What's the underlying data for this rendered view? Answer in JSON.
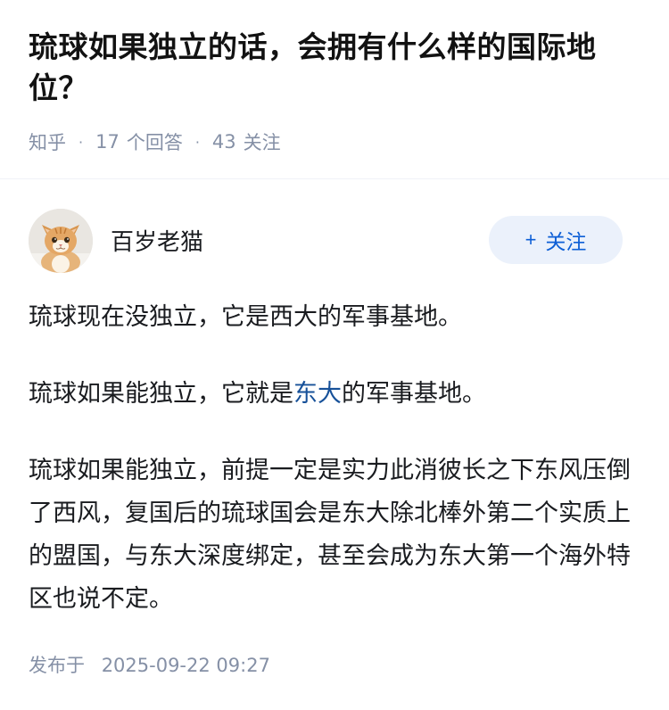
{
  "question": {
    "title": "琉球如果独立的话，会拥有什么样的国际地位？",
    "source": "知乎",
    "answer_count": "17",
    "answer_label": "个回答",
    "follower_count": "43",
    "follower_label": "关注"
  },
  "author": {
    "name": "百岁老猫",
    "avatar_icon": "cat-avatar-icon",
    "follow_plus": "+",
    "follow_label": "关注"
  },
  "answer": {
    "p1": "琉球现在没独立，它是西大的军事基地。",
    "p2_before": "琉球如果能独立，它就是",
    "p2_link": "东大",
    "p2_after": "的军事基地。",
    "p3": "琉球如果能独立，前提一定是实力此消彼长之下东风压倒了西风，复国后的琉球国会是东大除北棒外第二个实质上的盟国，与东大深度绑定，甚至会成为东大第一个海外特区也说不定。"
  },
  "footer": {
    "published_label": "发布于",
    "published_time": "2025-09-22 09:27"
  },
  "colors": {
    "link": "#175199",
    "follow_button_bg": "#ebf1fb",
    "follow_button_text": "#0d5fd6",
    "meta_text": "#8590a6"
  }
}
